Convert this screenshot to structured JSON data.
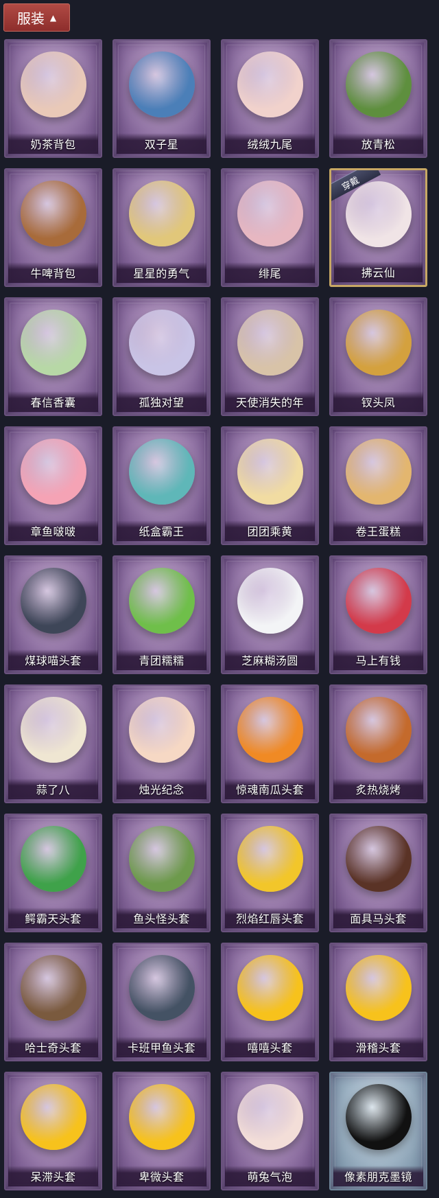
{
  "header": {
    "tab_label": "服装",
    "chevron_icon": "chevron-up-icon"
  },
  "equipped_badge": "穿戴",
  "items": [
    {
      "label": "奶茶背包",
      "icon": "milk-tea-backpack-icon",
      "color": "#e9c9b8"
    },
    {
      "label": "双子星",
      "icon": "twin-star-figure-icon",
      "color": "#4b7fb8"
    },
    {
      "label": "绒绒九尾",
      "icon": "nine-tail-fox-icon",
      "color": "#f1d2cc"
    },
    {
      "label": "放青松",
      "icon": "bonsai-pine-icon",
      "color": "#5e8f3e"
    },
    {
      "label": "牛啤背包",
      "icon": "cow-beer-barrel-icon",
      "color": "#a86b3a"
    },
    {
      "label": "星星的勇气",
      "icon": "star-keychain-icon",
      "color": "#e1c77a"
    },
    {
      "label": "绯尾",
      "icon": "pink-fox-keychain-icon",
      "color": "#e7b7c1"
    },
    {
      "label": "拂云仙",
      "icon": "cloud-immortal-keychain-icon",
      "color": "#f0e4e6",
      "equipped": true
    },
    {
      "label": "春信香囊",
      "icon": "green-sachet-icon",
      "color": "#b7d8a6"
    },
    {
      "label": "孤独对望",
      "icon": "lonely-gaze-keychain-icon",
      "color": "#c9c4e6"
    },
    {
      "label": "天使消失的年",
      "icon": "angel-keychain-icon",
      "color": "#d8c3a8"
    },
    {
      "label": "钗头凤",
      "icon": "phoenix-crown-keychain-icon",
      "color": "#d4a13e"
    },
    {
      "label": "章鱼啵啵",
      "icon": "pink-octopus-icon",
      "color": "#f5a3b5"
    },
    {
      "label": "纸盒霸王",
      "icon": "box-dinosaur-icon",
      "color": "#5fb7b8"
    },
    {
      "label": "团团乘黄",
      "icon": "cream-creature-icon",
      "color": "#f1dca2"
    },
    {
      "label": "卷王蛋糕",
      "icon": "roll-cake-icon",
      "color": "#e3b66f"
    },
    {
      "label": "煤球喵头套",
      "icon": "black-cat-mask-icon",
      "color": "#3e4658"
    },
    {
      "label": "青团糯糯",
      "icon": "green-rice-ball-icon",
      "color": "#6fbf4a"
    },
    {
      "label": "芝麻糊汤圆",
      "icon": "rice-dumpling-icon",
      "color": "#f3f4f6"
    },
    {
      "label": "马上有钱",
      "icon": "red-horse-mask-icon",
      "color": "#d33a4a"
    },
    {
      "label": "蒜了八",
      "icon": "garlic-icon",
      "color": "#efe6d2"
    },
    {
      "label": "烛光纪念",
      "icon": "candle-icon",
      "color": "#f6d8c4"
    },
    {
      "label": "惊魂南瓜头套",
      "icon": "pumpkin-mask-icon",
      "color": "#f08a24"
    },
    {
      "label": "炙热烧烤",
      "icon": "bbq-meat-icon",
      "color": "#c46a2c"
    },
    {
      "label": "鳄霸天头套",
      "icon": "crocodile-mask-icon",
      "color": "#3fa24a"
    },
    {
      "label": "鱼头怪头套",
      "icon": "fish-head-mask-icon",
      "color": "#6d9a4c"
    },
    {
      "label": "烈焰红唇头套",
      "icon": "yellow-rat-mask-icon",
      "color": "#f2c62a"
    },
    {
      "label": "面具马头套",
      "icon": "horse-head-mask-icon",
      "color": "#5a3326"
    },
    {
      "label": "哈士奇头套",
      "icon": "husky-mask-icon",
      "color": "#7a5a3e"
    },
    {
      "label": "卡班甲鱼头套",
      "icon": "whale-mask-icon",
      "color": "#445264"
    },
    {
      "label": "嘻嘻头套",
      "icon": "grinning-emoji-mask-icon",
      "color": "#f7c21c"
    },
    {
      "label": "滑稽头套",
      "icon": "funny-emoji-mask-icon",
      "color": "#f7c21c"
    },
    {
      "label": "呆滞头套",
      "icon": "dazed-emoji-mask-icon",
      "color": "#f7c21c"
    },
    {
      "label": "卑微头套",
      "icon": "humble-emoji-mask-icon",
      "color": "#f7c21c"
    },
    {
      "label": "萌兔气泡",
      "icon": "bunny-bubble-icon",
      "color": "#f3ded8"
    },
    {
      "label": "像素朋克墨镜",
      "icon": "pixel-sunglasses-icon",
      "color": "#111111",
      "blue": true
    }
  ]
}
